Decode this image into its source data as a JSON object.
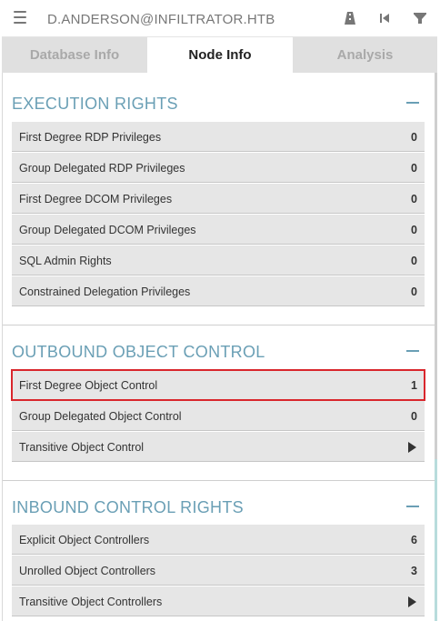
{
  "header": {
    "node_name": "D.ANDERSON@INFILTRATOR.HTB",
    "icons": [
      "menu-icon",
      "path-icon",
      "back-icon",
      "filter-icon"
    ]
  },
  "tabs": [
    {
      "label": "Database Info",
      "active": false
    },
    {
      "label": "Node Info",
      "active": true
    },
    {
      "label": "Analysis",
      "active": false
    }
  ],
  "sections": {
    "execution": {
      "title": "EXECUTION RIGHTS",
      "rows": [
        {
          "label": "First Degree RDP Privileges",
          "value": "0"
        },
        {
          "label": "Group Delegated RDP Privileges",
          "value": "0"
        },
        {
          "label": "First Degree DCOM Privileges",
          "value": "0"
        },
        {
          "label": "Group Delegated DCOM Privileges",
          "value": "0"
        },
        {
          "label": "SQL Admin Rights",
          "value": "0"
        },
        {
          "label": "Constrained Delegation Privileges",
          "value": "0"
        }
      ]
    },
    "outbound": {
      "title": "OUTBOUND OBJECT CONTROL",
      "rows": [
        {
          "label": "First Degree Object Control",
          "value": "1"
        },
        {
          "label": "Group Delegated Object Control",
          "value": "0"
        },
        {
          "label": "Transitive Object Control",
          "value": ""
        }
      ]
    },
    "inbound": {
      "title": "INBOUND CONTROL RIGHTS",
      "rows": [
        {
          "label": "Explicit Object Controllers",
          "value": "6"
        },
        {
          "label": "Unrolled Object Controllers",
          "value": "3"
        },
        {
          "label": "Transitive Object Controllers",
          "value": ""
        }
      ]
    }
  },
  "colors": {
    "section_title": "#6a9fb5",
    "row_bg": "#e6e6e6",
    "highlight": "#d9262c",
    "inactive_tab": "#e0e0e0"
  }
}
